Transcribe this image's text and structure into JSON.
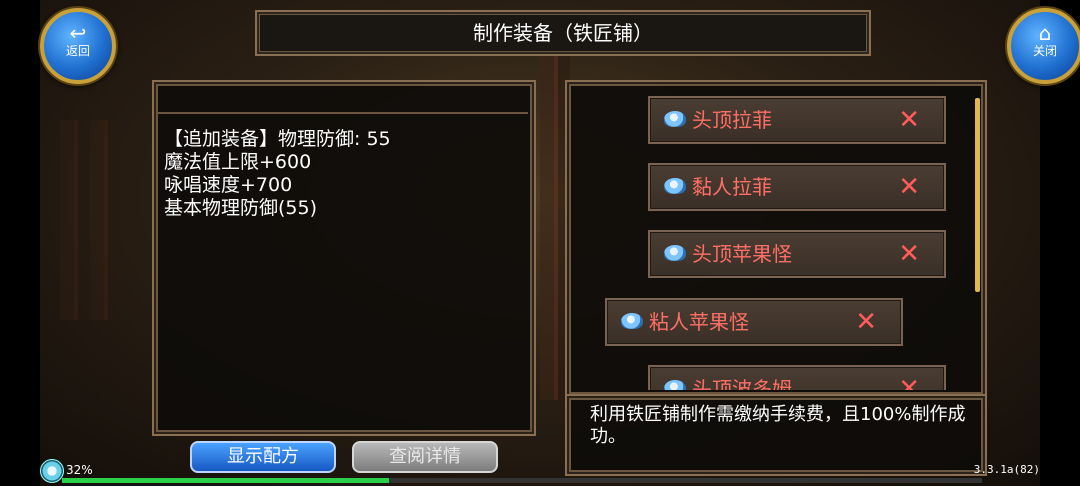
{
  "header": {
    "title": "制作装备（铁匠铺）"
  },
  "nav": {
    "back_label": "返回",
    "back_icon": "back-arrow-icon",
    "close_label": "关闭",
    "close_icon": "home-icon"
  },
  "equipment_description": [
    "【追加装备】物理防御: 55",
    "魔法值上限+600",
    "咏唱速度+700",
    "基本物理防御(55)"
  ],
  "materials": [
    {
      "name": "头顶拉菲"
    },
    {
      "name": "黏人拉菲"
    },
    {
      "name": "头顶苹果怪"
    },
    {
      "name": "粘人苹果怪"
    },
    {
      "name": "头顶波多姆"
    }
  ],
  "remove_symbol": "✕",
  "info_text": "利用铁匠铺制作需缴纳手续费，且100%制作成功。",
  "buttons": {
    "show_recipe": "显示配方",
    "view_details": "查阅详情"
  },
  "status": {
    "percent": "32%",
    "exp_progress": 0.355,
    "version": "3.3.1a(82)"
  },
  "colors": {
    "accent_gold": "#c9a13a",
    "material_name": "#ff6f66",
    "remove": "#ff5c5c",
    "exp": "#2ad04a"
  }
}
